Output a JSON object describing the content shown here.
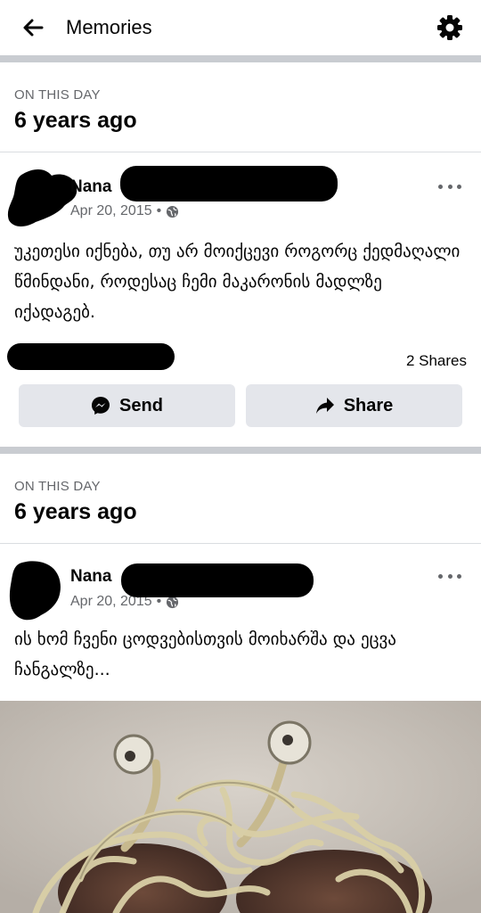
{
  "header": {
    "title": "Memories",
    "back_icon": "arrow-left-icon",
    "settings_icon": "gear-icon"
  },
  "memories": [
    {
      "label": "ON THIS DAY",
      "ago": "6 years ago",
      "author": "Nana",
      "date": "Apr 20, 2015",
      "separator": "•",
      "privacy_icon": "globe-icon",
      "text": "უკეთესი იქნება, თუ არ მოიქცევი როგორც ქედმაღალი წმინდანი, როდესაც ჩემი მაკარონის მადლზე იქადაგებ.",
      "shares": "2 Shares",
      "send_label": "Send",
      "share_label": "Share"
    },
    {
      "label": "ON THIS DAY",
      "ago": "6 years ago",
      "author": "Nana",
      "date": "Apr 20, 2015",
      "separator": "•",
      "privacy_icon": "globe-icon",
      "text": "ის ხომ ჩვენი ცოდვებისთვის მოიხარშა და ეცვა ჩანგალზე..."
    }
  ],
  "colors": {
    "divider": "#c9ccd1",
    "secondary_text": "#65676b",
    "button_bg": "#e4e6eb"
  }
}
